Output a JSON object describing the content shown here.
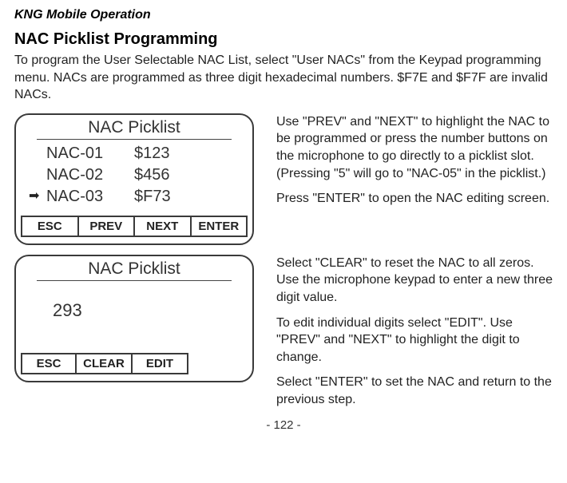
{
  "header": {
    "operation": "KNG Mobile Operation",
    "section_title": "NAC Picklist Programming",
    "intro": "To program the User Selectable NAC List, select \"User NACs\" from the Keypad programming menu. NACs are programmed as three digit hexadecimal numbers. $F7E and $F7F are invalid NACs."
  },
  "screen1": {
    "title": "NAC Picklist",
    "rows": [
      {
        "label": "NAC-01",
        "value": "$123",
        "selected": false
      },
      {
        "label": "NAC-02",
        "value": "$456",
        "selected": false
      },
      {
        "label": "NAC-03",
        "value": "$F73",
        "selected": true
      }
    ],
    "buttons": {
      "esc": "ESC",
      "prev": "PREV",
      "next": "NEXT",
      "enter": "ENTER"
    }
  },
  "text1": {
    "p1": "Use \"PREV\" and \"NEXT\" to highlight the NAC to be programmed or press the number buttons on the microphone to go directly to a picklist slot.",
    "p1b": "(Pressing \"5\" will go to \"NAC-05\" in the picklist.)",
    "p2": "Press \"ENTER\" to open the NAC editing screen."
  },
  "screen2": {
    "title": "NAC Picklist",
    "value": "293",
    "buttons": {
      "esc": "ESC",
      "clear": "CLEAR",
      "edit": "EDIT"
    }
  },
  "text2": {
    "p1": "Select \"CLEAR\" to reset the NAC to all zeros. Use the microphone keypad to enter a new three digit value.",
    "p2": "To edit individual digits select \"EDIT\". Use \"PREV\" and \"NEXT\" to highlight the digit to change.",
    "p3": "Select \"ENTER\" to set the NAC and return to the previous step."
  },
  "page": "- 122 -",
  "arrow_glyph": "➡"
}
